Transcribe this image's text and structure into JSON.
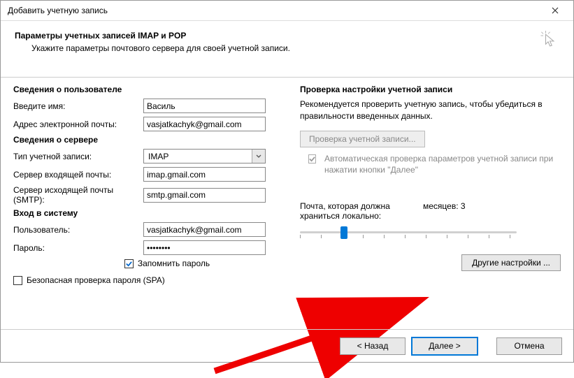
{
  "window": {
    "title": "Добавить учетную запись"
  },
  "header": {
    "title": "Параметры учетных записей IMAP и POP",
    "desc": "Укажите параметры почтового сервера для своей учетной записи."
  },
  "user_section": {
    "heading": "Сведения о пользователе",
    "name_label": "Введите имя:",
    "name_value": "Василь",
    "email_label": "Адрес электронной почты:",
    "email_value": "vasjatkachyk@gmail.com"
  },
  "server_section": {
    "heading": "Сведения о сервере",
    "type_label": "Тип учетной записи:",
    "type_value": "IMAP",
    "incoming_label": "Сервер входящей почты:",
    "incoming_value": "imap.gmail.com",
    "outgoing_label": "Сервер исходящей почты (SMTP):",
    "outgoing_value": "smtp.gmail.com"
  },
  "login_section": {
    "heading": "Вход в систему",
    "user_label": "Пользователь:",
    "user_value": "vasjatkachyk@gmail.com",
    "pass_label": "Пароль:",
    "pass_value": "********",
    "remember_label": "Запомнить пароль",
    "spa_label": "Безопасная проверка пароля (SPA)"
  },
  "test_section": {
    "heading": "Проверка настройки учетной записи",
    "desc": "Рекомендуется проверить учетную запись, чтобы убедиться в правильности введенных данных.",
    "test_button": "Проверка учетной записи...",
    "auto_check": "Автоматическая проверка параметров учетной записи при нажатии кнопки \"Далее\""
  },
  "slider": {
    "label_left": "Почта, которая должна храниться локально:",
    "label_right": "месяцев: 3"
  },
  "more_settings": "Другие настройки ...",
  "footer": {
    "back": "< Назад",
    "next": "Далее >",
    "cancel": "Отмена"
  }
}
